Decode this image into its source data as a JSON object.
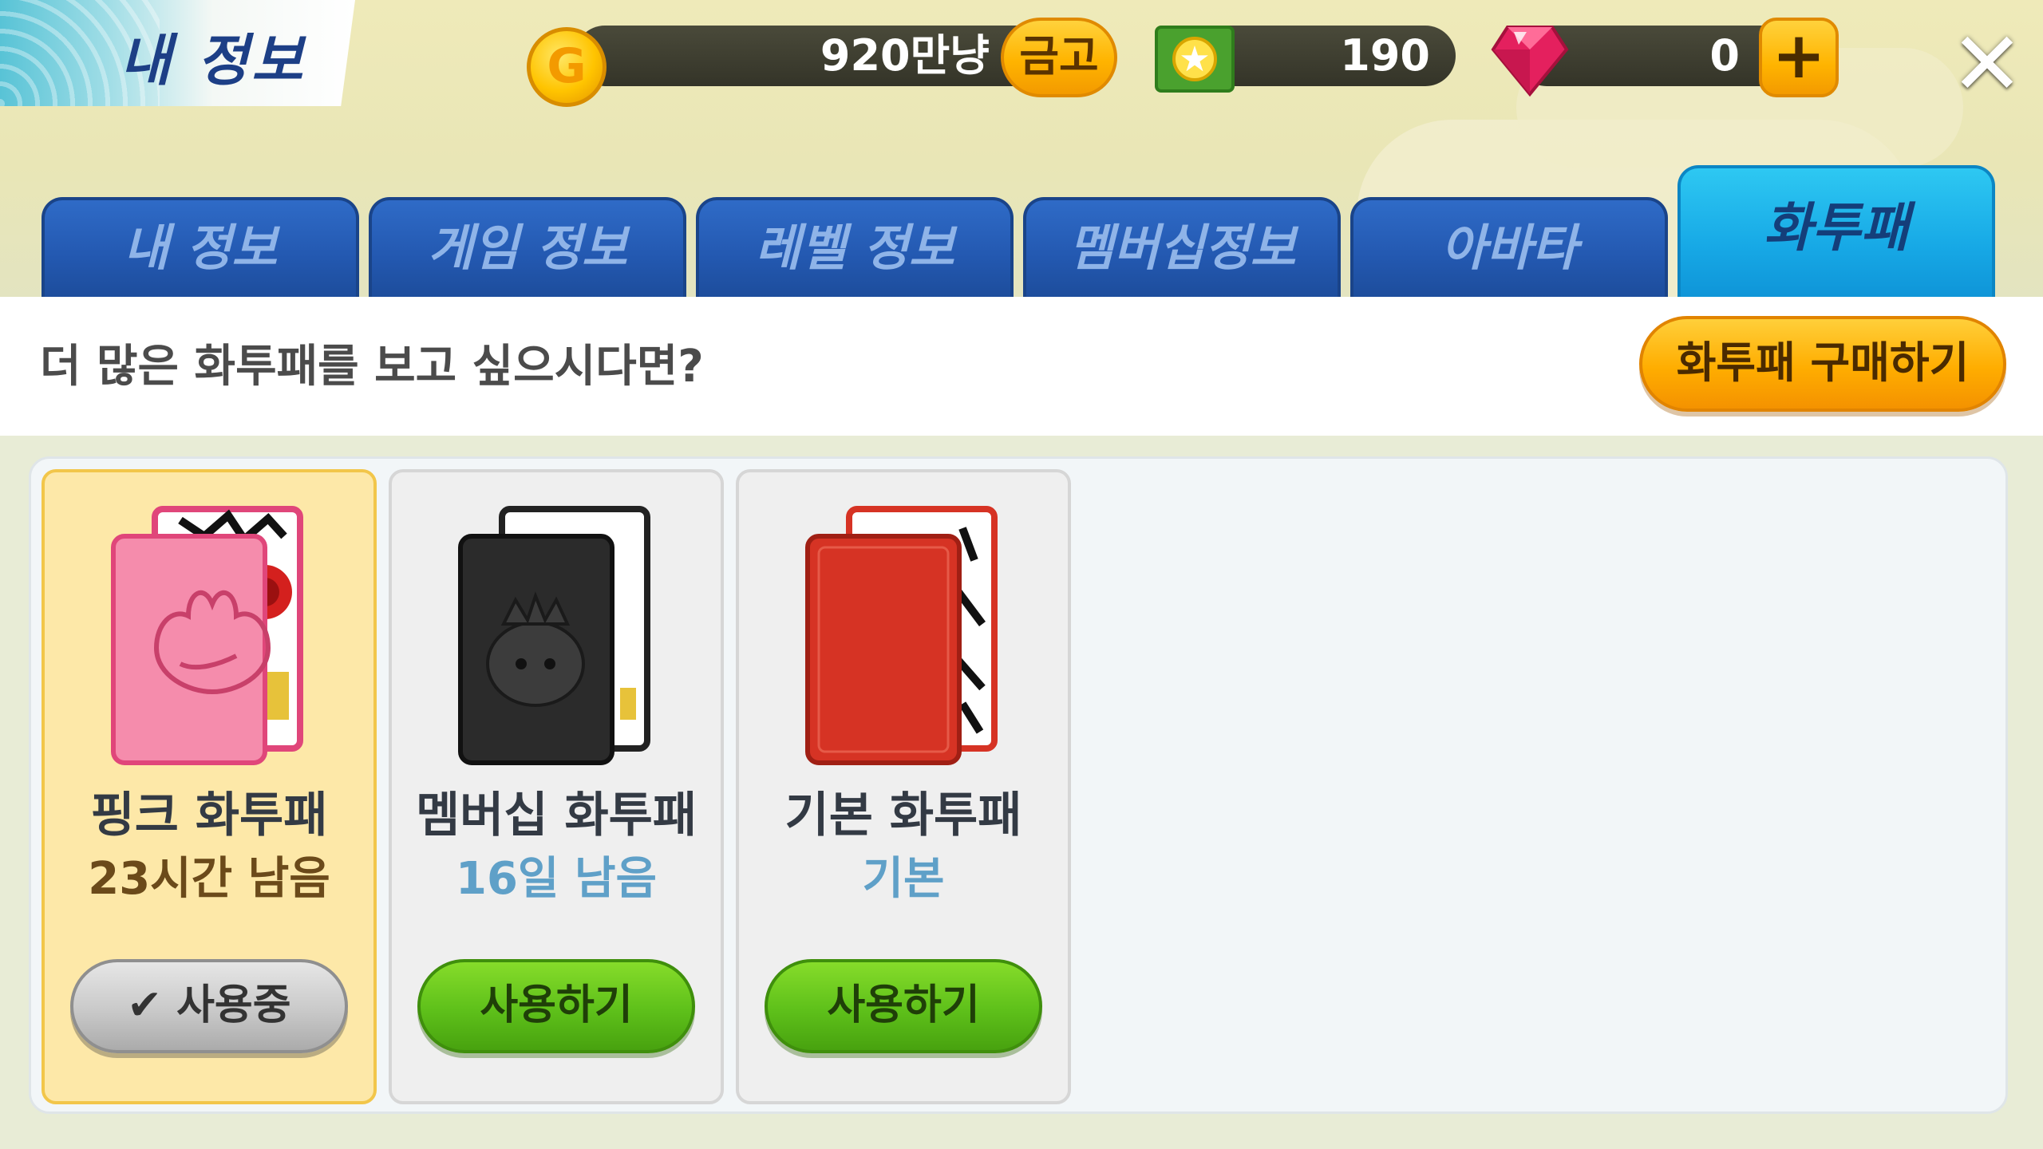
{
  "header": {
    "title": "내 정보",
    "gold": {
      "value": "920만냥",
      "button_label": "금고",
      "coin_letter": "G"
    },
    "tickets": {
      "value": "190"
    },
    "gems": {
      "value": "0",
      "add_label": "+"
    },
    "close_label": "✕"
  },
  "tabs": [
    {
      "label": "내 정보",
      "active": false
    },
    {
      "label": "게임 정보",
      "active": false
    },
    {
      "label": "레벨 정보",
      "active": false
    },
    {
      "label": "멤버십정보",
      "active": false
    },
    {
      "label": "아바타",
      "active": false
    },
    {
      "label": "화투패",
      "active": true
    }
  ],
  "promo": {
    "text": "더 많은 화투패를 보고 싶으시다면?",
    "buy_button": "화투패 구매하기"
  },
  "cards": [
    {
      "name": "핑크 화투패",
      "status": "23시간 남음",
      "button": "✔ 사용중",
      "selected": true,
      "color": "#f47aa0"
    },
    {
      "name": "멤버십 화투패",
      "status": "16일 남음",
      "button": "사용하기",
      "selected": false,
      "color": "#2b2b2b"
    },
    {
      "name": "기본 화투패",
      "status": "기본",
      "button": "사용하기",
      "selected": false,
      "color": "#d63324"
    }
  ],
  "colors": {
    "tab_blue": "#2358b0",
    "tab_active": "#17a9e6",
    "accent_orange": "#ffad00",
    "button_green": "#5ec01a",
    "selected_card": "#fde8a8"
  }
}
